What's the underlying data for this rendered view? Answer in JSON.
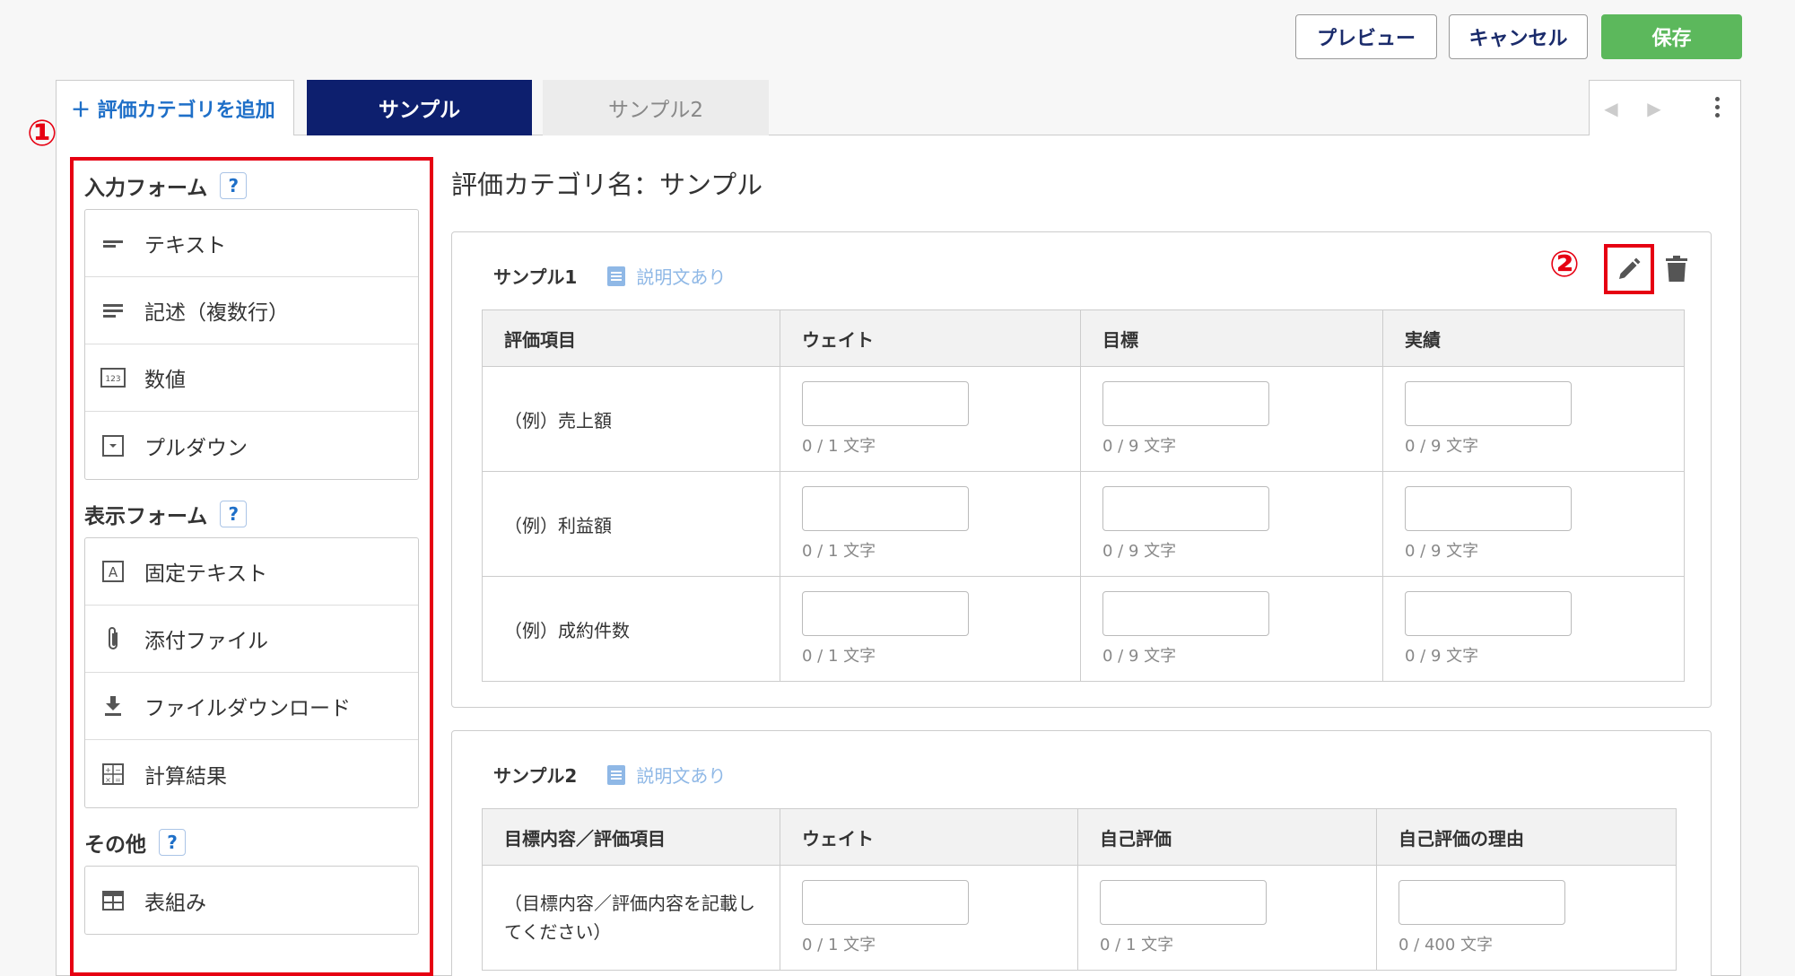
{
  "header": {
    "preview_label": "プレビュー",
    "cancel_label": "キャンセル",
    "save_label": "保存"
  },
  "tabs": {
    "add_label": "＋ 評価カテゴリを追加",
    "items": [
      {
        "label": "サンプル",
        "active": true
      },
      {
        "label": "サンプル2",
        "active": false
      }
    ]
  },
  "palette": {
    "groups": [
      {
        "title": "入力フォーム",
        "items": [
          {
            "label": "テキスト",
            "icon": "text-line-icon"
          },
          {
            "label": "記述（複数行）",
            "icon": "multiline-icon"
          },
          {
            "label": "数値",
            "icon": "number-icon"
          },
          {
            "label": "プルダウン",
            "icon": "dropdown-icon"
          }
        ]
      },
      {
        "title": "表示フォーム",
        "items": [
          {
            "label": "固定テキスト",
            "icon": "fixed-text-icon"
          },
          {
            "label": "添付ファイル",
            "icon": "paperclip-icon"
          },
          {
            "label": "ファイルダウンロード",
            "icon": "download-icon"
          },
          {
            "label": "計算結果",
            "icon": "calculator-icon"
          }
        ]
      },
      {
        "title": "その他",
        "items": [
          {
            "label": "表組み",
            "icon": "table-icon"
          }
        ]
      }
    ],
    "help_label": "?"
  },
  "annotations": {
    "one": "①",
    "two": "②"
  },
  "category": {
    "title": "評価カテゴリ名：サンプル"
  },
  "sections": [
    {
      "name": "サンプル1",
      "desc_label": "説明文あり",
      "columns": [
        "評価項目",
        "ウェイト",
        "目標",
        "実績"
      ],
      "rows": [
        {
          "label": "（例）売上額",
          "counts": [
            "0 / 1 文字",
            "0 / 9 文字",
            "0 / 9 文字"
          ]
        },
        {
          "label": "（例）利益額",
          "counts": [
            "0 / 1 文字",
            "0 / 9 文字",
            "0 / 9 文字"
          ]
        },
        {
          "label": "（例）成約件数",
          "counts": [
            "0 / 1 文字",
            "0 / 9 文字",
            "0 / 9 文字"
          ]
        }
      ]
    },
    {
      "name": "サンプル2",
      "desc_label": "説明文あり",
      "columns": [
        "目標内容／評価項目",
        "ウェイト",
        "自己評価",
        "自己評価の理由"
      ],
      "rows": [
        {
          "label": "（目標内容／評価内容を記載してください）",
          "counts": [
            "0 / 1 文字",
            "0 / 1 文字",
            "0 / 400 文字"
          ]
        }
      ]
    }
  ]
}
